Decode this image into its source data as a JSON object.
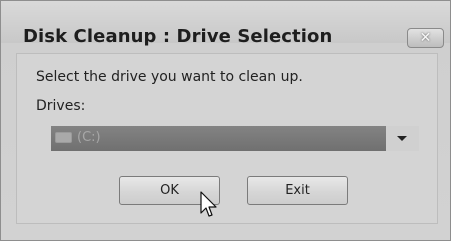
{
  "window": {
    "title": "Disk Cleanup : Drive Selection"
  },
  "dialog": {
    "prompt": "Select the drive you want to clean up.",
    "drives_label": "Drives:",
    "selected_drive": "(C:)",
    "ok_label": "OK",
    "exit_label": "Exit"
  },
  "icons": {
    "close": "close-icon",
    "drive": "hard-drive-icon",
    "dropdown": "chevron-down-icon",
    "cursor": "mouse-cursor-icon"
  },
  "colors": {
    "selection": "#777777",
    "background": "#d2d2d2"
  }
}
